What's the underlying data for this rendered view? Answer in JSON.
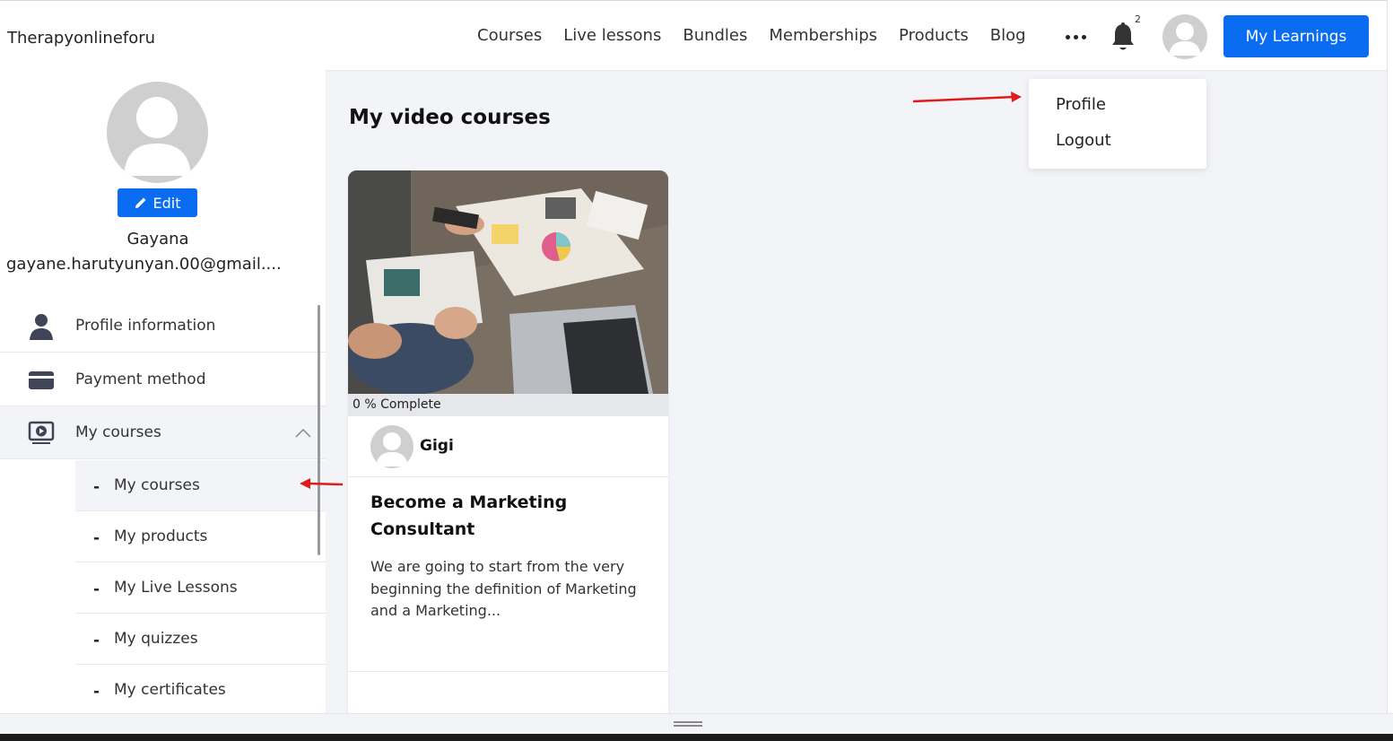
{
  "header": {
    "brand": "Therapyonlineforu",
    "nav": [
      "Courses",
      "Live lessons",
      "Bundles",
      "Memberships",
      "Products",
      "Blog"
    ],
    "notification_count": "2",
    "cta_label": "My Learnings",
    "accent": "#0a6cf0"
  },
  "dropdown": {
    "items": [
      "Profile",
      "Logout"
    ]
  },
  "sidebar": {
    "edit_label": "Edit",
    "user_name": "Gayana",
    "user_email": "gayane.harutyunyan.00@gmail....",
    "menu": [
      {
        "label": "Profile information",
        "icon": "person-icon"
      },
      {
        "label": "Payment method",
        "icon": "card-icon"
      },
      {
        "label": "My courses",
        "icon": "video-course-icon"
      }
    ],
    "submenu": [
      "My courses",
      "My products",
      "My Live Lessons",
      "My quizzes",
      "My certificates"
    ]
  },
  "main": {
    "title": "My video courses",
    "course": {
      "progress_text": "0 % Complete",
      "progress_percent": 0,
      "author": "Gigi",
      "title": "Become a Marketing Consultant",
      "description": "We are going to start from the very beginning the definition of Marketing and a Marketing..."
    }
  }
}
